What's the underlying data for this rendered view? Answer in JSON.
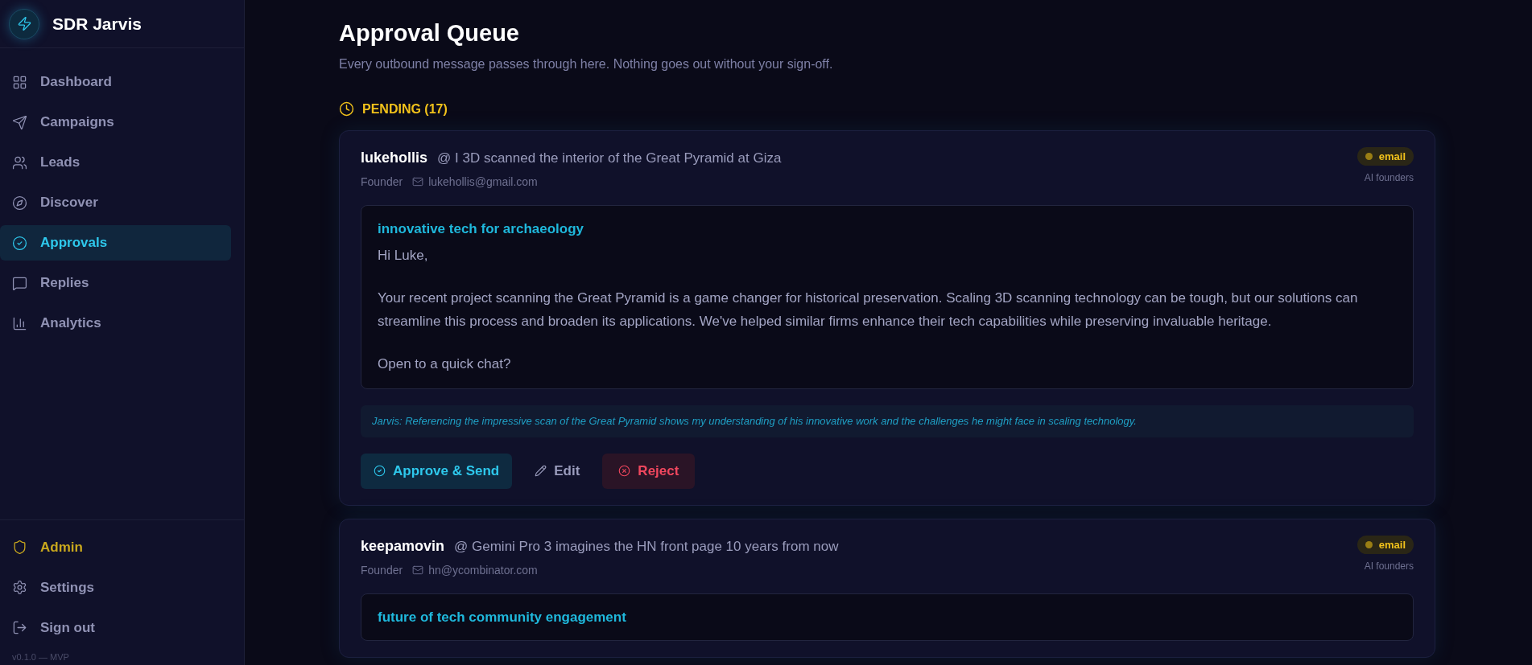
{
  "app": {
    "name": "SDR Jarvis",
    "version": "v0.1.0 — MVP"
  },
  "nav": [
    {
      "label": "Dashboard",
      "selected": false
    },
    {
      "label": "Campaigns",
      "selected": false
    },
    {
      "label": "Leads",
      "selected": false
    },
    {
      "label": "Discover",
      "selected": false
    },
    {
      "label": "Approvals",
      "selected": true
    },
    {
      "label": "Replies",
      "selected": false
    },
    {
      "label": "Analytics",
      "selected": false
    }
  ],
  "footer_nav": [
    {
      "label": "Admin",
      "kind": "admin"
    },
    {
      "label": "Settings",
      "kind": "normal"
    },
    {
      "label": "Sign out",
      "kind": "normal"
    }
  ],
  "page": {
    "title": "Approval Queue",
    "subtitle": "Every outbound message passes through here. Nothing goes out without your sign-off."
  },
  "section": {
    "label": "PENDING (17)"
  },
  "cards": [
    {
      "name": "lukehollis",
      "context": "@ I 3D scanned the interior of the Great Pyramid at Giza",
      "role": "Founder",
      "email": "lukehollis@gmail.com",
      "channel": "email",
      "segment": "AI founders",
      "subject": "innovative tech for archaeology",
      "body": [
        "Hi Luke,",
        "Your recent project scanning the Great Pyramid is a game changer for historical preservation. Scaling 3D scanning technology can be tough, but our solutions can streamline this process and broaden its applications. We've helped similar firms enhance their tech capabilities while preserving invaluable heritage.",
        "Open to a quick chat?"
      ],
      "note": "Jarvis: Referencing the impressive scan of the Great Pyramid shows my understanding of his innovative work and the challenges he might face in scaling technology.",
      "actions": [
        {
          "label": "Approve & Send",
          "kind": "approve"
        },
        {
          "label": "Edit",
          "kind": "edit"
        },
        {
          "label": "Reject",
          "kind": "reject"
        }
      ]
    },
    {
      "name": "keepamovin",
      "context": "@ Gemini Pro 3 imagines the HN front page 10 years from now",
      "role": "Founder",
      "email": "hn@ycombinator.com",
      "channel": "email",
      "segment": "AI founders",
      "subject": "future of tech community engagement"
    }
  ]
}
